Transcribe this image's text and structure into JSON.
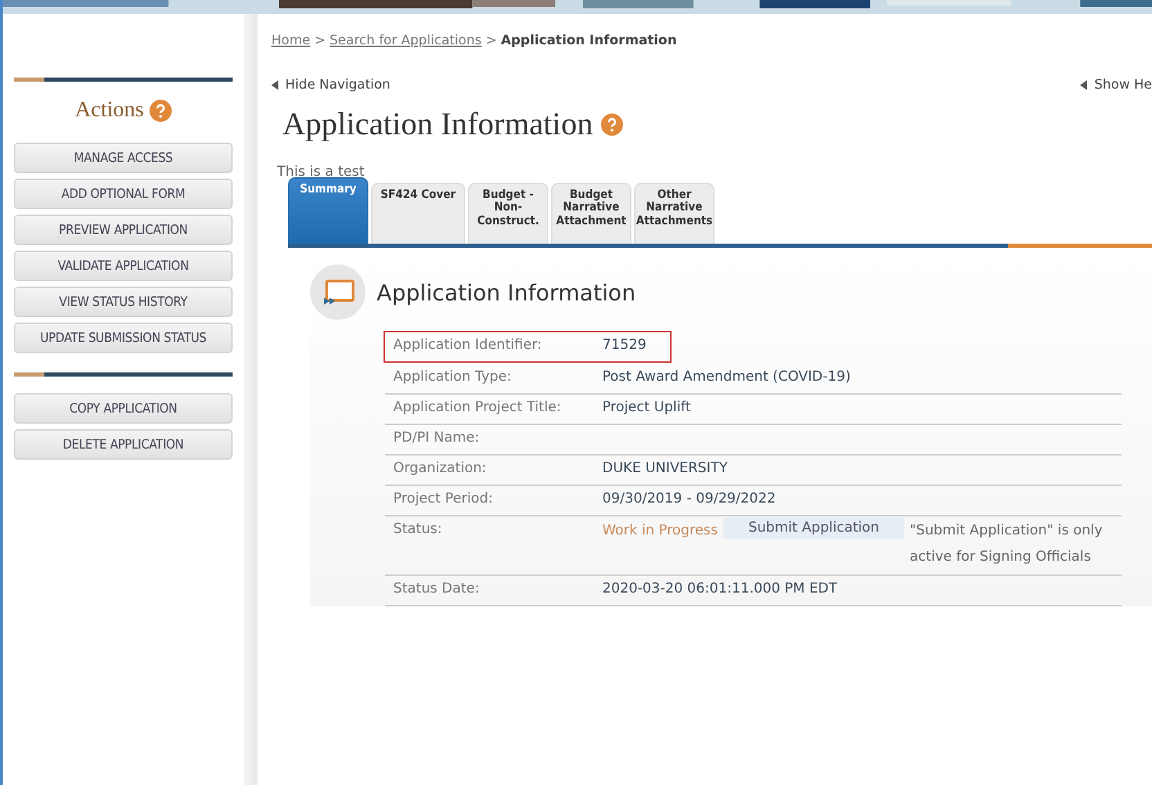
{
  "sidebar": {
    "title": "Actions",
    "groups": [
      {
        "buttons": [
          "MANAGE ACCESS",
          "ADD OPTIONAL FORM",
          "PREVIEW APPLICATION",
          "VALIDATE APPLICATION",
          "VIEW STATUS HISTORY",
          "UPDATE SUBMISSION STATUS"
        ]
      },
      {
        "buttons": [
          "COPY APPLICATION",
          "DELETE APPLICATION"
        ]
      }
    ]
  },
  "breadcrumb": [
    {
      "kind": "link",
      "label": "Home"
    },
    {
      "kind": "sep",
      "label": ">"
    },
    {
      "kind": "link",
      "label": "Search for Applications"
    },
    {
      "kind": "sep",
      "label": ">"
    },
    {
      "kind": "current",
      "label": "Application Information"
    }
  ],
  "hide_navigation": "Hide Navigation",
  "show_help": "Show He",
  "page_title": "Application Information",
  "note": "This is a test",
  "tabs": [
    {
      "label": "Summary",
      "selected": true
    },
    {
      "label": "SF424 Cover",
      "selected": false
    },
    {
      "label": "Budget - Non-Construct.",
      "selected": false
    },
    {
      "label": "Budget Narrative Attachment",
      "selected": false
    },
    {
      "label": "Other Narrative Attachments",
      "selected": false
    }
  ],
  "section_title": "Application Information",
  "rows": [
    {
      "kind": "plain",
      "label": "Application Identifier:",
      "value": "71529",
      "highlighted": true
    },
    {
      "kind": "plain",
      "label": "Application Type:",
      "value": "Post Award Amendment (COVID-19)",
      "highlighted": false
    },
    {
      "kind": "plain",
      "label": "Application Project Title:",
      "value": "Project Uplift",
      "highlighted": false
    },
    {
      "kind": "plain",
      "label": "PD/PI Name:",
      "highlighted": false
    },
    {
      "kind": "plain",
      "label": "Organization:",
      "value": "DUKE UNIVERSITY",
      "highlighted": false
    },
    {
      "kind": "plain",
      "label": "Project Period:",
      "value": "09/30/2019 - 09/29/2022",
      "highlighted": false
    },
    {
      "kind": "status",
      "label": "Status:",
      "value": "Work in Progress",
      "button": "Submit Application",
      "button_disabled": true,
      "note": "\"Submit Application\" is only active for Signing Officials",
      "highlighted": false
    },
    {
      "kind": "plain",
      "label": "Status Date:",
      "value": "2020-03-20 06:01:11.000 PM EDT",
      "highlighted": false
    }
  ]
}
